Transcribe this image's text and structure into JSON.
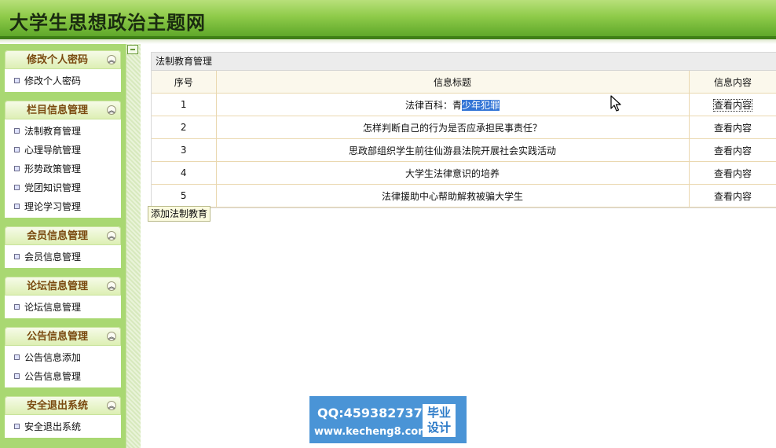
{
  "site": {
    "title": "大学生思想政治主题网"
  },
  "sidebar": {
    "groups": [
      {
        "title": "修改个人密码",
        "items": [
          "修改个人密码"
        ]
      },
      {
        "title": "栏目信息管理",
        "items": [
          "法制教育管理",
          "心理导航管理",
          "形势政策管理",
          "党团知识管理",
          "理论学习管理"
        ]
      },
      {
        "title": "会员信息管理",
        "items": [
          "会员信息管理"
        ]
      },
      {
        "title": "论坛信息管理",
        "items": [
          "论坛信息管理"
        ]
      },
      {
        "title": "公告信息管理",
        "items": [
          "公告信息添加",
          "公告信息管理"
        ]
      },
      {
        "title": "安全退出系统",
        "items": [
          "安全退出系统"
        ]
      }
    ]
  },
  "panel": {
    "title": "法制教育管理",
    "columns": [
      "序号",
      "信息标题",
      "信息内容"
    ],
    "rows": [
      {
        "index": "1",
        "title_prefix": "法律百科：青",
        "title_selected": "少年犯罪",
        "action": "查看内容"
      },
      {
        "index": "2",
        "title": "怎样判断自己的行为是否应承担民事责任？",
        "action": "查看内容"
      },
      {
        "index": "3",
        "title": "思政部组织学生前往仙游县法院开展社会实践活动",
        "action": "查看内容"
      },
      {
        "index": "4",
        "title": "大学生法律意识的培养",
        "action": "查看内容"
      },
      {
        "index": "5",
        "title": "法律援助中心帮助解救被骗大学生",
        "action": "查看内容"
      }
    ],
    "add_button": "添加法制教育"
  },
  "watermark": {
    "qq": "QQ:459382737",
    "url": "www.kecheng8.com",
    "badge": "毕业\n设计"
  },
  "colors": {
    "header_green": "#8fcb4a",
    "sidebar_green": "#a9d872",
    "selection_blue": "#3375d6"
  }
}
